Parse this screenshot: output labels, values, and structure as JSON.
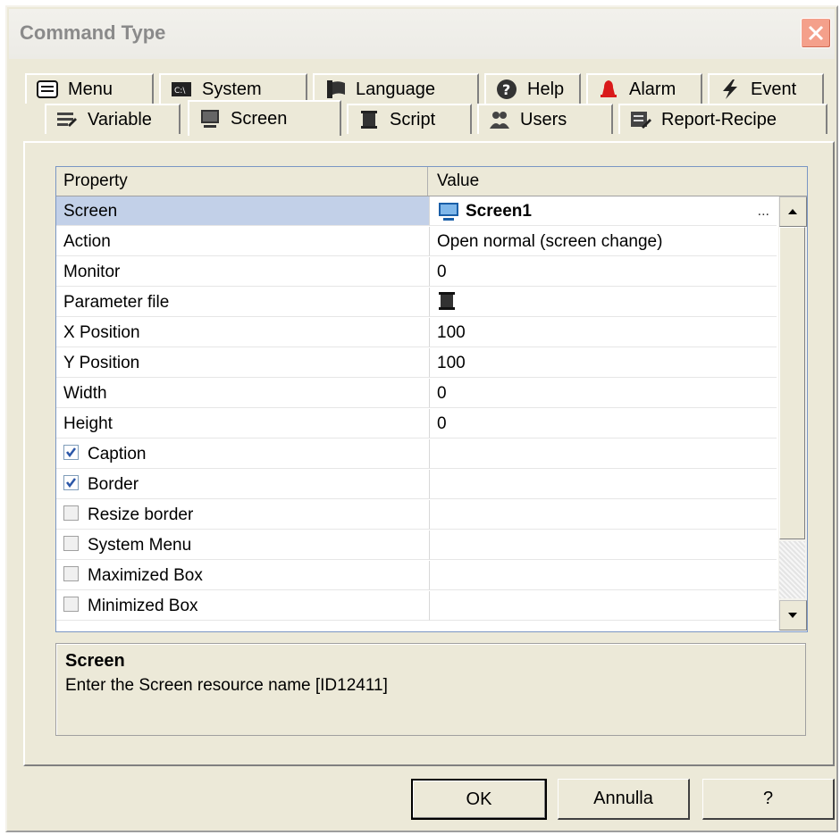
{
  "window": {
    "title": "Command Type"
  },
  "tabs": {
    "row1": [
      {
        "label": "Menu",
        "icon": "menu-icon"
      },
      {
        "label": "System",
        "icon": "system-icon"
      },
      {
        "label": "Language",
        "icon": "language-icon"
      },
      {
        "label": "Help",
        "icon": "help-icon"
      },
      {
        "label": "Alarm",
        "icon": "alarm-icon"
      },
      {
        "label": "Event",
        "icon": "event-icon"
      }
    ],
    "row2": [
      {
        "label": "Variable",
        "icon": "variable-icon"
      },
      {
        "label": "Screen",
        "icon": "screen-icon",
        "active": true
      },
      {
        "label": "Script",
        "icon": "script-icon"
      },
      {
        "label": "Users",
        "icon": "users-icon"
      },
      {
        "label": "Report-Recipe",
        "icon": "report-recipe-icon"
      }
    ]
  },
  "grid": {
    "header": {
      "property": "Property",
      "value": "Value"
    },
    "rows": [
      {
        "property": "Screen",
        "value": "Screen1",
        "selected": true
      },
      {
        "property": "Action",
        "value": "Open normal (screen change)"
      },
      {
        "property": "Monitor",
        "value": "0"
      },
      {
        "property": "Parameter file",
        "value": ""
      },
      {
        "property": "X Position",
        "value": "100"
      },
      {
        "property": "Y Position",
        "value": "100"
      },
      {
        "property": "Width",
        "value": "0"
      },
      {
        "property": "Height",
        "value": "0"
      },
      {
        "property": "Caption",
        "checked": true
      },
      {
        "property": "Border",
        "checked": true
      },
      {
        "property": "Resize border",
        "checked": false
      },
      {
        "property": "System Menu",
        "checked": false
      },
      {
        "property": "Maximized Box",
        "checked": false
      },
      {
        "property": "Minimized Box",
        "checked": false
      }
    ],
    "ellipsis": "..."
  },
  "description": {
    "title": "Screen",
    "text": "Enter the Screen resource name [ID12411]"
  },
  "buttons": {
    "ok": "OK",
    "cancel": "Annulla",
    "help": "?"
  },
  "colors": {
    "selected_row": "#c2d0e8",
    "close_button": "#f4a08b",
    "dialog_bg": "#ece9d8"
  }
}
